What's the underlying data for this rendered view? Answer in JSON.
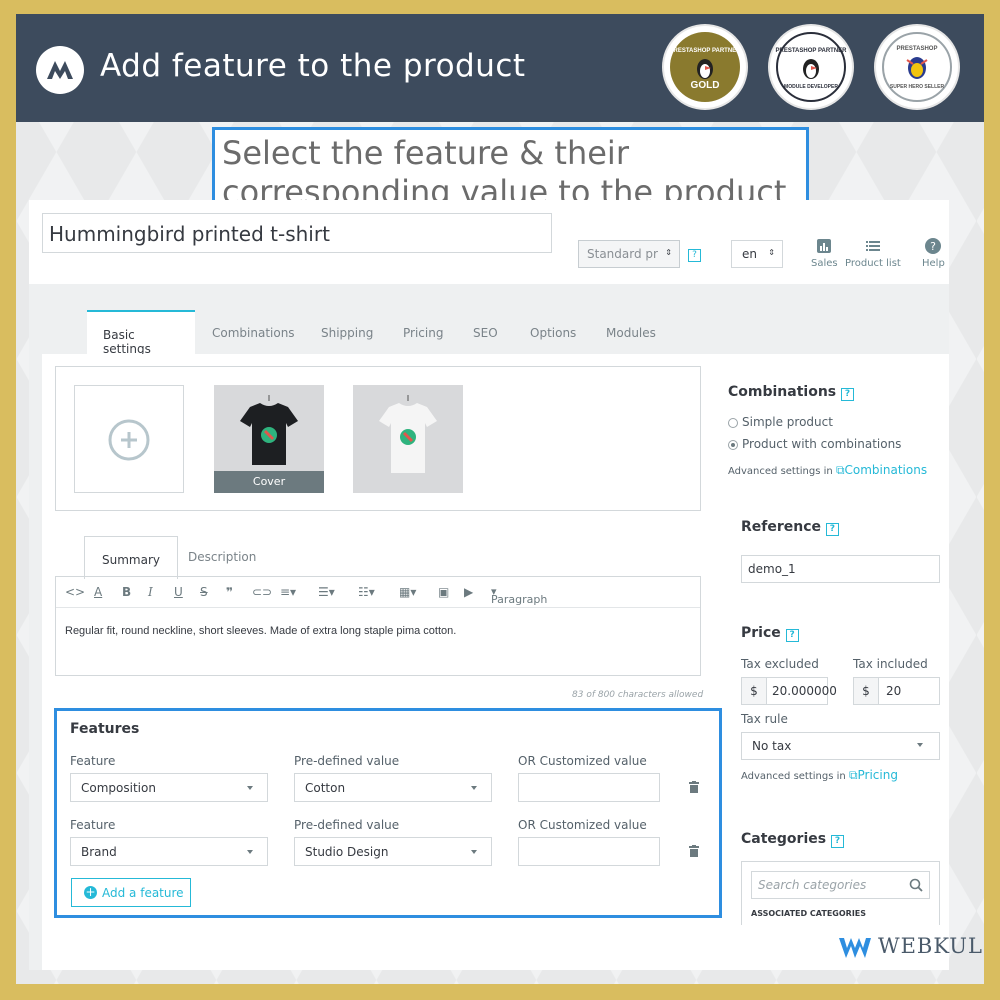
{
  "banner": {
    "title": "Add feature to the product"
  },
  "badges": [
    {
      "top": "PRESTASHOP PARTNER",
      "bottom": "GOLD"
    },
    {
      "top": "PRESTASHOP PARTNER",
      "bottom": "MODULE DEVELOPER"
    },
    {
      "top": "PRESTASHOP",
      "bottom": "SUPER HERO SELLER"
    }
  ],
  "callout": {
    "line1": "Select the feature & their",
    "line2": "corresponding value to the product"
  },
  "header": {
    "product_name": "Hummingbird printed t-shirt",
    "product_type": "Standard pr",
    "language": "en",
    "tools": {
      "sales": "Sales",
      "product_list": "Product list",
      "help": "Help"
    }
  },
  "tabs": [
    "Basic settings",
    "Combinations",
    "Shipping",
    "Pricing",
    "SEO",
    "Options",
    "Modules"
  ],
  "images": {
    "cover_label": "Cover"
  },
  "summary_tabs": [
    "Summary",
    "Description"
  ],
  "editor": {
    "paragraph_label": "Paragraph",
    "text": "Regular fit, round neckline, short sleeves. Made of extra long staple pima cotton.",
    "char_count": "83 of 800 characters allowed"
  },
  "features": {
    "heading": "Features",
    "col_feature": "Feature",
    "col_predefined": "Pre-defined value",
    "col_custom": "OR Customized value",
    "rows": [
      {
        "feature": "Composition",
        "value": "Cotton",
        "custom": ""
      },
      {
        "feature": "Brand",
        "value": "Studio Design",
        "custom": ""
      }
    ],
    "add_label": "Add a feature"
  },
  "sidebar": {
    "combinations": {
      "heading": "Combinations",
      "simple": "Simple product",
      "with_combos": "Product with combinations",
      "selected": "with_combos",
      "adv_prefix": "Advanced settings in",
      "adv_link": "Combinations"
    },
    "reference": {
      "heading": "Reference",
      "value": "demo_1"
    },
    "price": {
      "heading": "Price",
      "tax_excl_label": "Tax excluded",
      "tax_incl_label": "Tax included",
      "currency": "$",
      "tax_excl_value": "20.000000",
      "tax_incl_value": "20",
      "tax_rule_label": "Tax rule",
      "tax_rule_value": "No tax",
      "adv_prefix": "Advanced settings in",
      "adv_link": "Pricing"
    },
    "categories": {
      "heading": "Categories",
      "search_placeholder": "Search categories",
      "associated": "ASSOCIATED CATEGORIES"
    }
  },
  "brand": {
    "name": "WEBKUL"
  },
  "colors": {
    "accent": "#25b9d7",
    "highlight": "#2e8ee0",
    "banner": "#3d4b5d",
    "frame": "#d9bd5f"
  }
}
